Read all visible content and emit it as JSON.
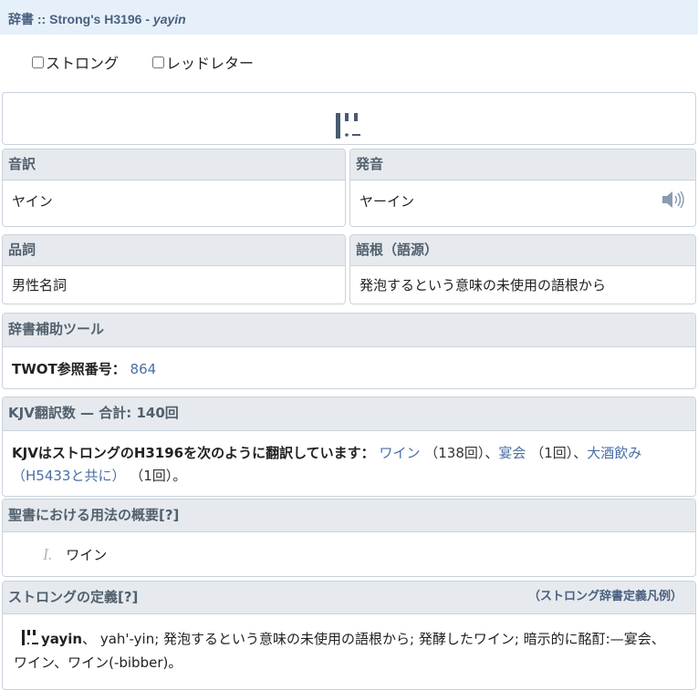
{
  "title": {
    "prefix": "辞書 :: Strong's H3196 - ",
    "word": "yayin"
  },
  "options": {
    "strongs_label": "ストロング",
    "redletter_label": "レッドレター"
  },
  "transliteration": {
    "header": "音訳",
    "value": "ヤイン"
  },
  "pronunciation": {
    "header": "発音",
    "value": "ヤーイン"
  },
  "part_of_speech": {
    "header": "品詞",
    "value": "男性名詞"
  },
  "root": {
    "header": "語根（語源）",
    "value": "発泡するという意味の未使用の語根から"
  },
  "lexicon_aids": {
    "header": "辞書補助ツール",
    "twot_label": "TWOT参照番号：",
    "twot_value": "864"
  },
  "kjv": {
    "header": "KJV翻訳数 — 合計: 140回",
    "intro": "KJVはストロングのH3196を次のように翻訳しています：",
    "t1": "ワイン",
    "c1": "（138回）、",
    "t2": "宴会",
    "c2": "（1回）、",
    "t3a": "大酒飲み",
    "t3b": "（H5433と共に）",
    "c3": "（1回）。"
  },
  "usage": {
    "header": "聖書における用法の概要[?]",
    "num": "I.",
    "item": "ワイン"
  },
  "strongs_def": {
    "header": "ストロングの定義[?]",
    "legend": "（ストロング辞書定義凡例）",
    "word": "yayin",
    "line1": "、 yah'-yin; 発泡するという意味の未使用の語根から; 発酵したワイン; 暗示的に酩酊:—宴会、",
    "line2": "ワイン、ワイン(-bibber)。"
  },
  "colors": {
    "title_bg": "#e6f0fa",
    "header_bg": "#e6eaee",
    "link": "#4a6fa5",
    "border": "#c9d2dc"
  }
}
